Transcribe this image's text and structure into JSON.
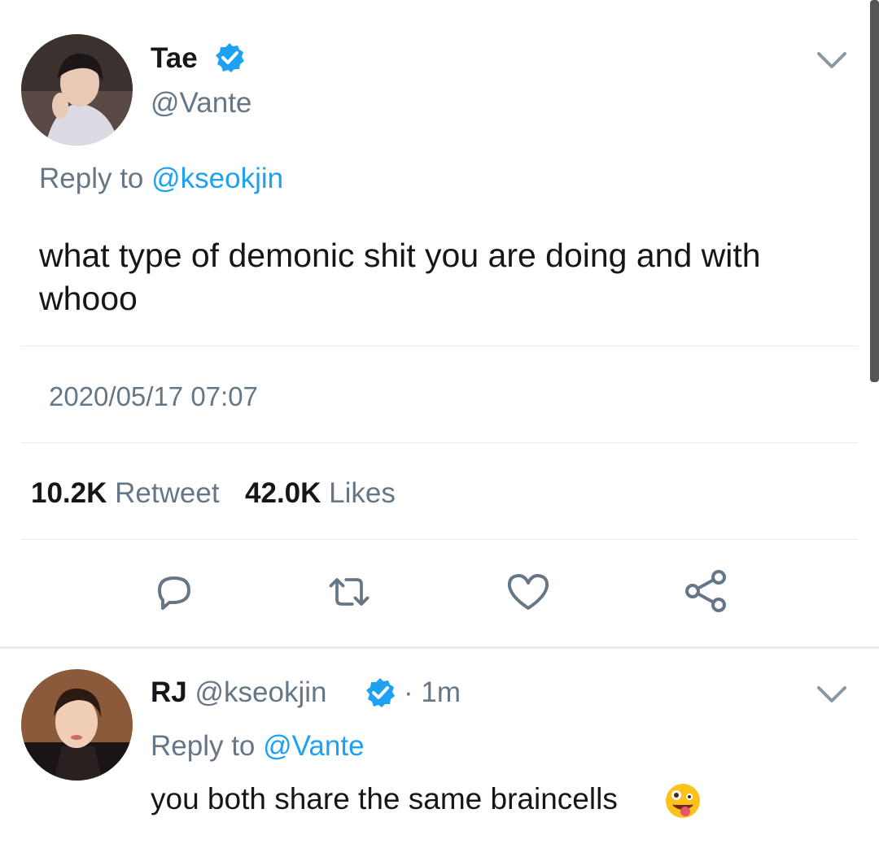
{
  "tweet": {
    "author_name": "Tae",
    "author_handle": "@Vante",
    "reply_prefix": "Reply to",
    "reply_handle": "@kseokjin",
    "text": "what type of demonic shit you are doing and with whooo",
    "timestamp": "2020/05/17 07:07",
    "retweet_count": "10.2K",
    "retweet_label": "Retweet",
    "like_count": "42.0K",
    "like_label": "Likes"
  },
  "reply": {
    "author_name": "RJ",
    "author_handle": "@kseokjin",
    "time": "· 1m",
    "reply_prefix": "Reply to",
    "reply_handle": "@Vante",
    "text": "you both share the same braincells",
    "emoji": "zany-face"
  },
  "icons": {
    "verified": "verified-badge-icon",
    "reply": "reply-icon",
    "retweet": "retweet-icon",
    "like": "heart-icon",
    "share": "share-icon",
    "more": "chevron-down-icon"
  },
  "colors": {
    "accent": "#1da1f2",
    "muted": "#657786",
    "text": "#14171a",
    "divider": "#e6ecf0"
  }
}
